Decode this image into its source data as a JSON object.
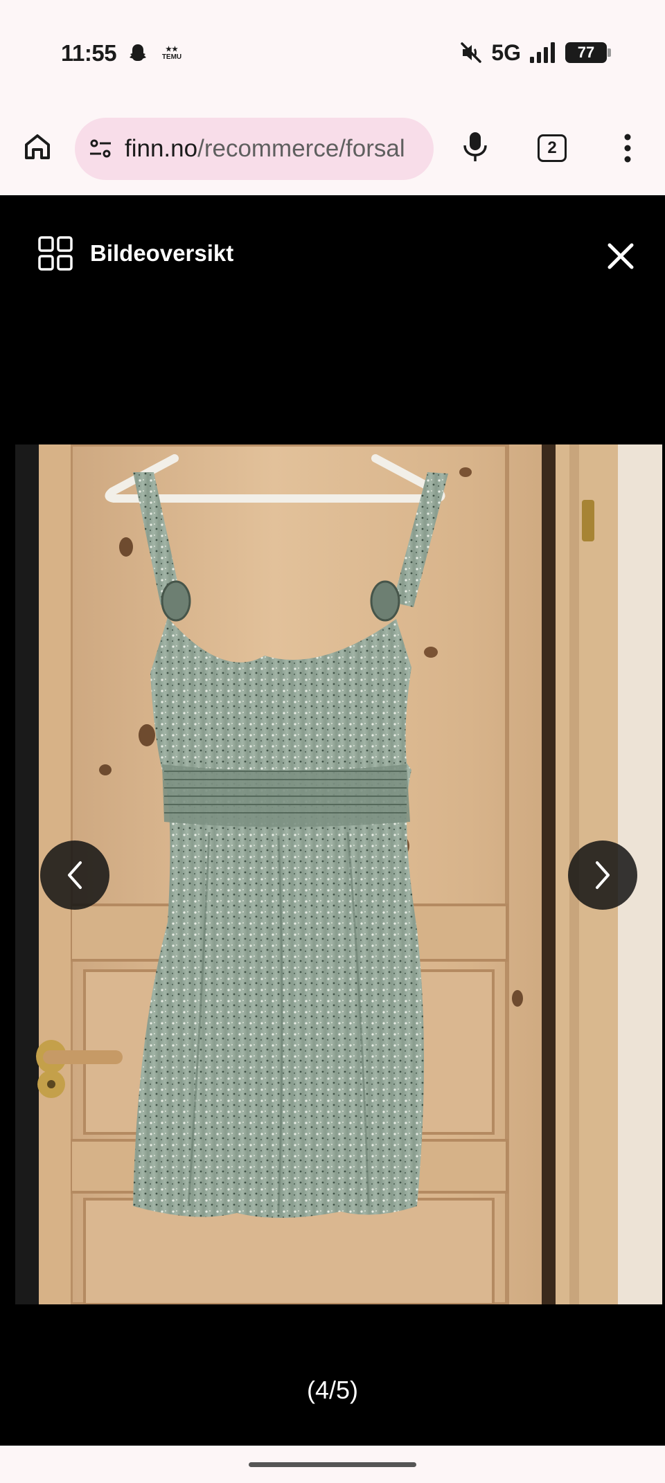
{
  "status_bar": {
    "time": "11:55",
    "temu_badge": "TEMU",
    "network": "5G",
    "battery": "77"
  },
  "browser": {
    "url_domain": "finn.no",
    "url_path": "/recommerce/forsal",
    "tab_count": "2"
  },
  "viewer": {
    "title": "Bildeoversikt",
    "counter": "(4/5)",
    "current_image": 4,
    "total_images": 5
  },
  "icons": {
    "home": "home-icon",
    "site_settings": "tune-icon",
    "mic": "mic-icon",
    "menu": "more-vert-icon",
    "grid": "grid-icon",
    "close": "close-icon",
    "prev": "chevron-left-icon",
    "next": "chevron-right-icon"
  }
}
